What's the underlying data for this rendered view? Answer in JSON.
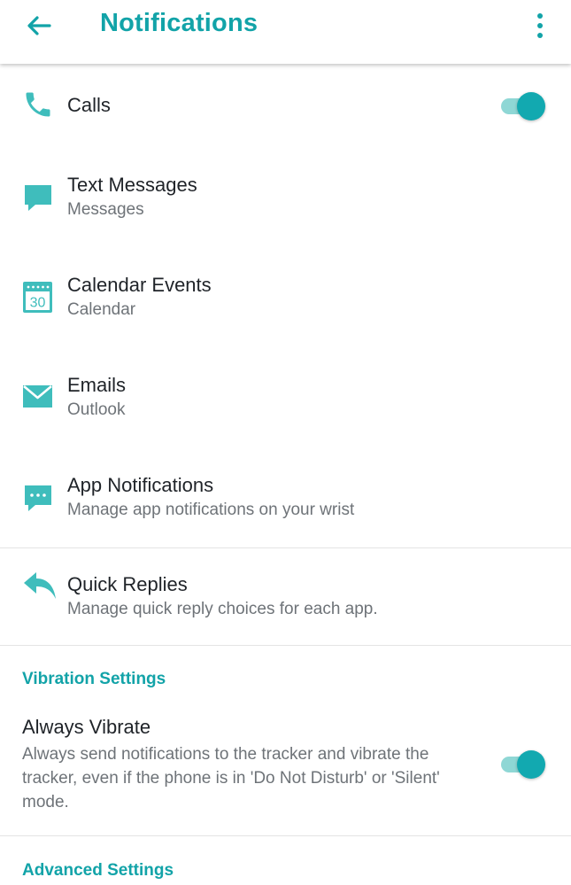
{
  "appbar": {
    "title": "Notifications",
    "back_icon": "arrow-back-icon",
    "more_icon": "more-vertical-icon"
  },
  "colors": {
    "accent": "#12a3a8",
    "toggle_thumb": "#12a9b0",
    "toggle_track": "#8fd7d5",
    "primary_text": "#1f2328",
    "secondary_text": "#6e7378",
    "divider": "#e4e4e4"
  },
  "notifications": {
    "calls": {
      "title": "Calls",
      "icon": "phone-icon",
      "enabled": true
    },
    "text_messages": {
      "title": "Text Messages",
      "subtitle": "Messages",
      "icon": "message-icon"
    },
    "calendar_events": {
      "title": "Calendar Events",
      "subtitle": "Calendar",
      "icon": "calendar-icon",
      "icon_text": "30"
    },
    "emails": {
      "title": "Emails",
      "subtitle": "Outlook",
      "icon": "mail-icon"
    },
    "app_notifications": {
      "title": "App Notifications",
      "subtitle": "Manage app notifications on your wrist",
      "icon": "chat-dots-icon"
    }
  },
  "quick_replies": {
    "title": "Quick Replies",
    "subtitle": "Manage quick reply choices for each app.",
    "icon": "reply-icon"
  },
  "vibration": {
    "header": "Vibration Settings",
    "always_vibrate": {
      "title": "Always Vibrate",
      "description": "Always send notifications to the tracker and vibrate the tracker, even if the phone is in 'Do Not Disturb' or 'Silent' mode.",
      "enabled": true
    }
  },
  "advanced": {
    "header": "Advanced Settings"
  }
}
